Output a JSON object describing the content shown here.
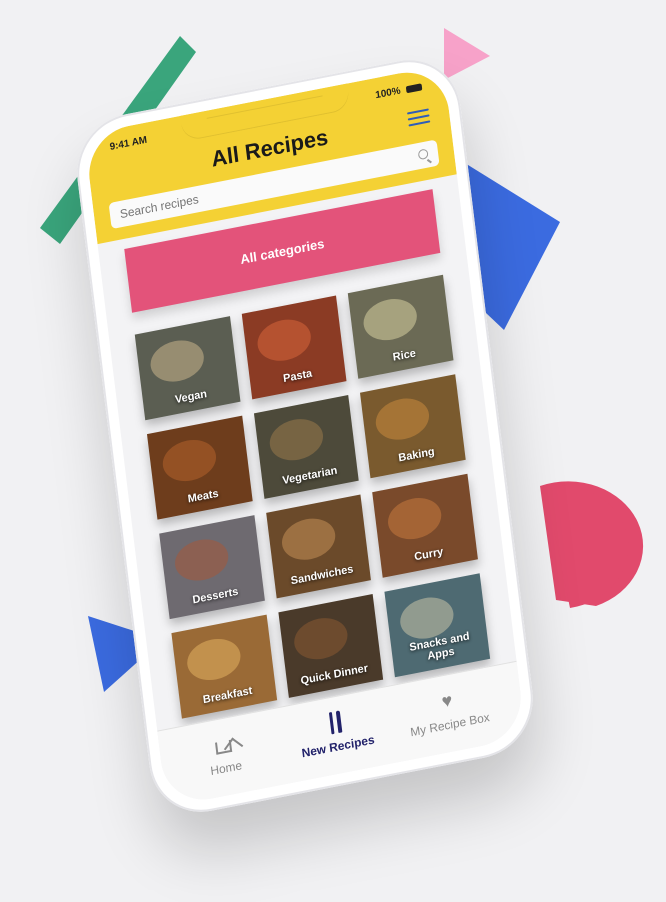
{
  "colors": {
    "header": "#f4d134",
    "accent_pink": "#e3537a",
    "tab_active": "#23236b",
    "shape_green": "#3aa57c",
    "shape_pink": "#f7a2c9",
    "shape_blue": "#3b6be0",
    "shape_red": "#e14a6c"
  },
  "statusbar": {
    "time": "9:41 AM",
    "battery": "100%"
  },
  "header": {
    "title": "All Recipes",
    "menu_icon": "hamburger-icon"
  },
  "search": {
    "placeholder": "Search recipes",
    "icon": "search-icon"
  },
  "all_categories": {
    "label": "All categories"
  },
  "categories": [
    {
      "label": "Vegan",
      "tint": "#5b5e52"
    },
    {
      "label": "Pasta",
      "tint": "#8b3b24"
    },
    {
      "label": "Rice",
      "tint": "#6b6a55"
    },
    {
      "label": "Meats",
      "tint": "#6e3d1c"
    },
    {
      "label": "Vegetarian",
      "tint": "#4d4a3a"
    },
    {
      "label": "Baking",
      "tint": "#7a5a2e"
    },
    {
      "label": "Desserts",
      "tint": "#6e6a70"
    },
    {
      "label": "Sandwiches",
      "tint": "#6b4a2a"
    },
    {
      "label": "Curry",
      "tint": "#7a4a2b"
    },
    {
      "label": "Breakfast",
      "tint": "#9a6a36"
    },
    {
      "label": "Quick Dinner",
      "tint": "#4a3a2a"
    },
    {
      "label": "Snacks and Apps",
      "tint": "#4e6a72"
    }
  ],
  "tabbar": {
    "items": [
      {
        "label": "Home",
        "icon": "home-icon"
      },
      {
        "label": "New Recipes",
        "icon": "fork-knife-icon"
      },
      {
        "label": "My Recipe Box",
        "icon": "heart-icon"
      }
    ]
  }
}
